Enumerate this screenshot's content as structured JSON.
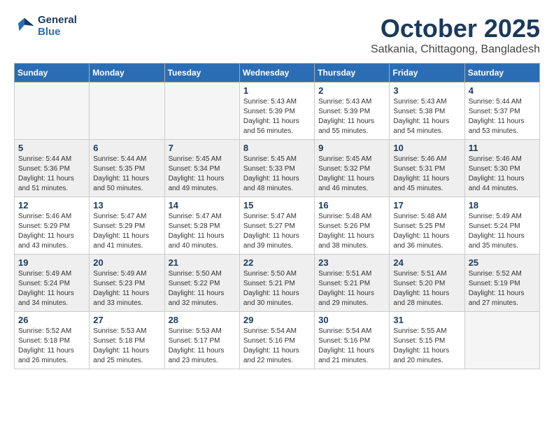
{
  "header": {
    "logo_line1": "General",
    "logo_line2": "Blue",
    "month": "October 2025",
    "location": "Satkania, Chittagong, Bangladesh"
  },
  "weekdays": [
    "Sunday",
    "Monday",
    "Tuesday",
    "Wednesday",
    "Thursday",
    "Friday",
    "Saturday"
  ],
  "weeks": [
    [
      {
        "day": "",
        "text": ""
      },
      {
        "day": "",
        "text": ""
      },
      {
        "day": "",
        "text": ""
      },
      {
        "day": "1",
        "text": "Sunrise: 5:43 AM\nSunset: 5:39 PM\nDaylight: 11 hours\nand 56 minutes."
      },
      {
        "day": "2",
        "text": "Sunrise: 5:43 AM\nSunset: 5:39 PM\nDaylight: 11 hours\nand 55 minutes."
      },
      {
        "day": "3",
        "text": "Sunrise: 5:43 AM\nSunset: 5:38 PM\nDaylight: 11 hours\nand 54 minutes."
      },
      {
        "day": "4",
        "text": "Sunrise: 5:44 AM\nSunset: 5:37 PM\nDaylight: 11 hours\nand 53 minutes."
      }
    ],
    [
      {
        "day": "5",
        "text": "Sunrise: 5:44 AM\nSunset: 5:36 PM\nDaylight: 11 hours\nand 51 minutes."
      },
      {
        "day": "6",
        "text": "Sunrise: 5:44 AM\nSunset: 5:35 PM\nDaylight: 11 hours\nand 50 minutes."
      },
      {
        "day": "7",
        "text": "Sunrise: 5:45 AM\nSunset: 5:34 PM\nDaylight: 11 hours\nand 49 minutes."
      },
      {
        "day": "8",
        "text": "Sunrise: 5:45 AM\nSunset: 5:33 PM\nDaylight: 11 hours\nand 48 minutes."
      },
      {
        "day": "9",
        "text": "Sunrise: 5:45 AM\nSunset: 5:32 PM\nDaylight: 11 hours\nand 46 minutes."
      },
      {
        "day": "10",
        "text": "Sunrise: 5:46 AM\nSunset: 5:31 PM\nDaylight: 11 hours\nand 45 minutes."
      },
      {
        "day": "11",
        "text": "Sunrise: 5:46 AM\nSunset: 5:30 PM\nDaylight: 11 hours\nand 44 minutes."
      }
    ],
    [
      {
        "day": "12",
        "text": "Sunrise: 5:46 AM\nSunset: 5:29 PM\nDaylight: 11 hours\nand 43 minutes."
      },
      {
        "day": "13",
        "text": "Sunrise: 5:47 AM\nSunset: 5:29 PM\nDaylight: 11 hours\nand 41 minutes."
      },
      {
        "day": "14",
        "text": "Sunrise: 5:47 AM\nSunset: 5:28 PM\nDaylight: 11 hours\nand 40 minutes."
      },
      {
        "day": "15",
        "text": "Sunrise: 5:47 AM\nSunset: 5:27 PM\nDaylight: 11 hours\nand 39 minutes."
      },
      {
        "day": "16",
        "text": "Sunrise: 5:48 AM\nSunset: 5:26 PM\nDaylight: 11 hours\nand 38 minutes."
      },
      {
        "day": "17",
        "text": "Sunrise: 5:48 AM\nSunset: 5:25 PM\nDaylight: 11 hours\nand 36 minutes."
      },
      {
        "day": "18",
        "text": "Sunrise: 5:49 AM\nSunset: 5:24 PM\nDaylight: 11 hours\nand 35 minutes."
      }
    ],
    [
      {
        "day": "19",
        "text": "Sunrise: 5:49 AM\nSunset: 5:24 PM\nDaylight: 11 hours\nand 34 minutes."
      },
      {
        "day": "20",
        "text": "Sunrise: 5:49 AM\nSunset: 5:23 PM\nDaylight: 11 hours\nand 33 minutes."
      },
      {
        "day": "21",
        "text": "Sunrise: 5:50 AM\nSunset: 5:22 PM\nDaylight: 11 hours\nand 32 minutes."
      },
      {
        "day": "22",
        "text": "Sunrise: 5:50 AM\nSunset: 5:21 PM\nDaylight: 11 hours\nand 30 minutes."
      },
      {
        "day": "23",
        "text": "Sunrise: 5:51 AM\nSunset: 5:21 PM\nDaylight: 11 hours\nand 29 minutes."
      },
      {
        "day": "24",
        "text": "Sunrise: 5:51 AM\nSunset: 5:20 PM\nDaylight: 11 hours\nand 28 minutes."
      },
      {
        "day": "25",
        "text": "Sunrise: 5:52 AM\nSunset: 5:19 PM\nDaylight: 11 hours\nand 27 minutes."
      }
    ],
    [
      {
        "day": "26",
        "text": "Sunrise: 5:52 AM\nSunset: 5:18 PM\nDaylight: 11 hours\nand 26 minutes."
      },
      {
        "day": "27",
        "text": "Sunrise: 5:53 AM\nSunset: 5:18 PM\nDaylight: 11 hours\nand 25 minutes."
      },
      {
        "day": "28",
        "text": "Sunrise: 5:53 AM\nSunset: 5:17 PM\nDaylight: 11 hours\nand 23 minutes."
      },
      {
        "day": "29",
        "text": "Sunrise: 5:54 AM\nSunset: 5:16 PM\nDaylight: 11 hours\nand 22 minutes."
      },
      {
        "day": "30",
        "text": "Sunrise: 5:54 AM\nSunset: 5:16 PM\nDaylight: 11 hours\nand 21 minutes."
      },
      {
        "day": "31",
        "text": "Sunrise: 5:55 AM\nSunset: 5:15 PM\nDaylight: 11 hours\nand 20 minutes."
      },
      {
        "day": "",
        "text": ""
      }
    ]
  ]
}
